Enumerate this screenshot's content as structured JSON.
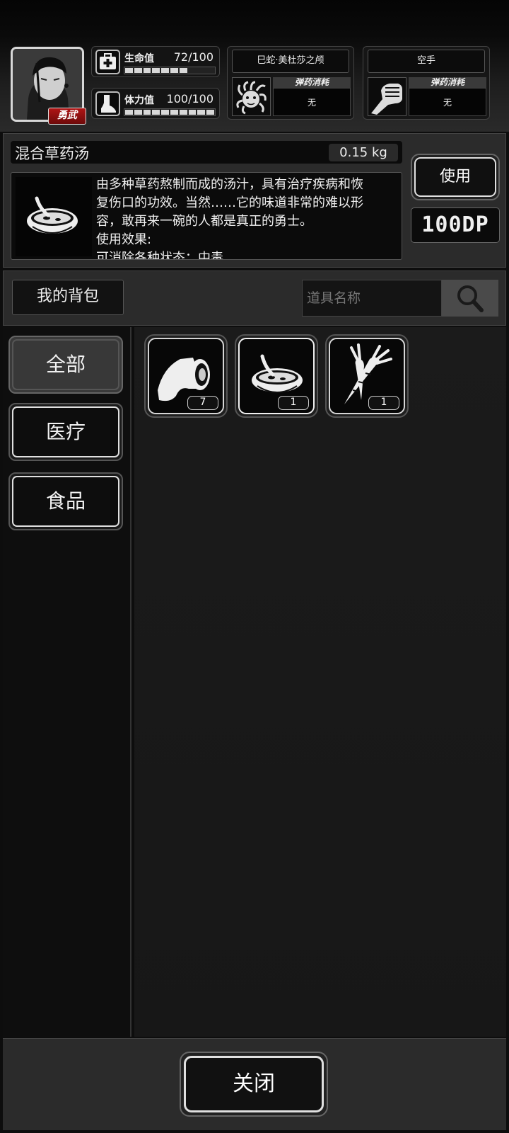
{
  "player": {
    "avatar_icon": "player-portrait-icon",
    "rank_badge": "勇武",
    "health": {
      "label": "生命值",
      "value": "72/100",
      "current": 72,
      "max": 100,
      "icon": "first-aid-icon"
    },
    "stamina": {
      "label": "体力值",
      "value": "100/100",
      "current": 100,
      "max": 100,
      "icon": "foot-icon"
    }
  },
  "weapons": [
    {
      "name": "巳蛇·美杜莎之颅",
      "icon": "medusa-head-icon",
      "ammo_label": "弹药消耗",
      "ammo_value": "无"
    },
    {
      "name": "空手",
      "icon": "fist-icon",
      "ammo_label": "弹药消耗",
      "ammo_value": "无"
    }
  ],
  "selected_item": {
    "name": "混合草药汤",
    "weight": "0.15 kg",
    "icon": "herbal-soup-bowl-icon",
    "description_lines": [
      "由多种草药熬制而成的汤汁，具有治疗疾病和恢",
      "复伤口的功效。当然……它的味道非常的难以形",
      "容，敢再来一碗的人都是真正的勇士。",
      "使用效果:",
      "可消除各种状态：中毒"
    ],
    "use_label": "使用",
    "dp": "100DP"
  },
  "bag": {
    "title": "我的背包",
    "search_placeholder": "道具名称",
    "search_icon": "magnifier-icon"
  },
  "categories": [
    {
      "label": "全部",
      "active": true
    },
    {
      "label": "医疗",
      "active": false
    },
    {
      "label": "食品",
      "active": false
    }
  ],
  "items": [
    {
      "icon": "bandage-roll-icon",
      "count": "7",
      "selected": false
    },
    {
      "icon": "herbal-soup-bowl-icon",
      "count": "1",
      "selected": true
    },
    {
      "icon": "carrot-icon",
      "count": "1",
      "selected": false
    }
  ],
  "close_label": "关闭"
}
